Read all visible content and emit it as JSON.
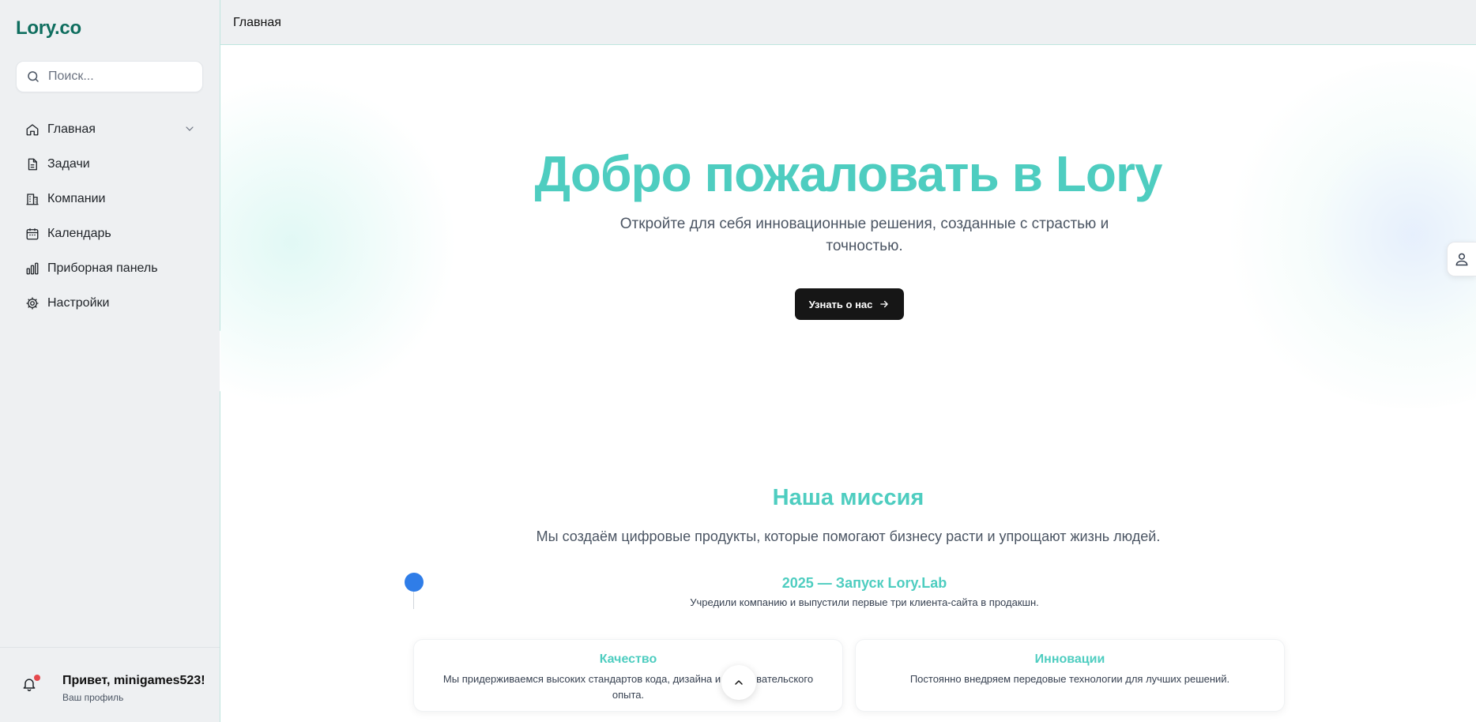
{
  "app": {
    "logo": "Lory.co"
  },
  "search": {
    "placeholder": "Поиск..."
  },
  "sidebar": {
    "items": [
      {
        "label": "Главная",
        "icon": "home-icon",
        "expandable": true
      },
      {
        "label": "Задачи",
        "icon": "file-icon"
      },
      {
        "label": "Компании",
        "icon": "building-icon"
      },
      {
        "label": "Календарь",
        "icon": "calendar-icon"
      },
      {
        "label": "Приборная панель",
        "icon": "bar-chart-icon"
      },
      {
        "label": "Настройки",
        "icon": "gear-icon"
      }
    ],
    "footer": {
      "greeting": "Привет, minigames523!",
      "profile_link": "Ваш профиль",
      "notification_dot_color": "#e5484d"
    }
  },
  "topbar": {
    "breadcrumb": "Главная"
  },
  "hero": {
    "title": "Добро пожаловать в Lory",
    "subtitle": "Откройте для себя инновационные решения, созданные с страстью и точностью.",
    "button_label": "Узнать о нас"
  },
  "mission": {
    "title": "Наша миссия",
    "subtitle": "Мы создаём цифровые продукты, которые помогают бизнесу расти и упрощают жизнь людей."
  },
  "timeline": {
    "title": "2025 — Запуск Lory.Lab",
    "description": "Учредили компанию и выпустили первые три клиента-сайта в продакшн."
  },
  "cards": [
    {
      "title": "Качество",
      "description": "Мы придерживаемся высоких стандартов кода, дизайна и пользовательского опыта."
    },
    {
      "title": "Инновации",
      "description": "Постоянно внедряем передовые технологии для лучших решений."
    }
  ],
  "colors": {
    "accent": "#4ecdc0",
    "brand": "#0f6e5f",
    "timeline_dot": "#2f7de8",
    "button_bg": "#161616"
  }
}
